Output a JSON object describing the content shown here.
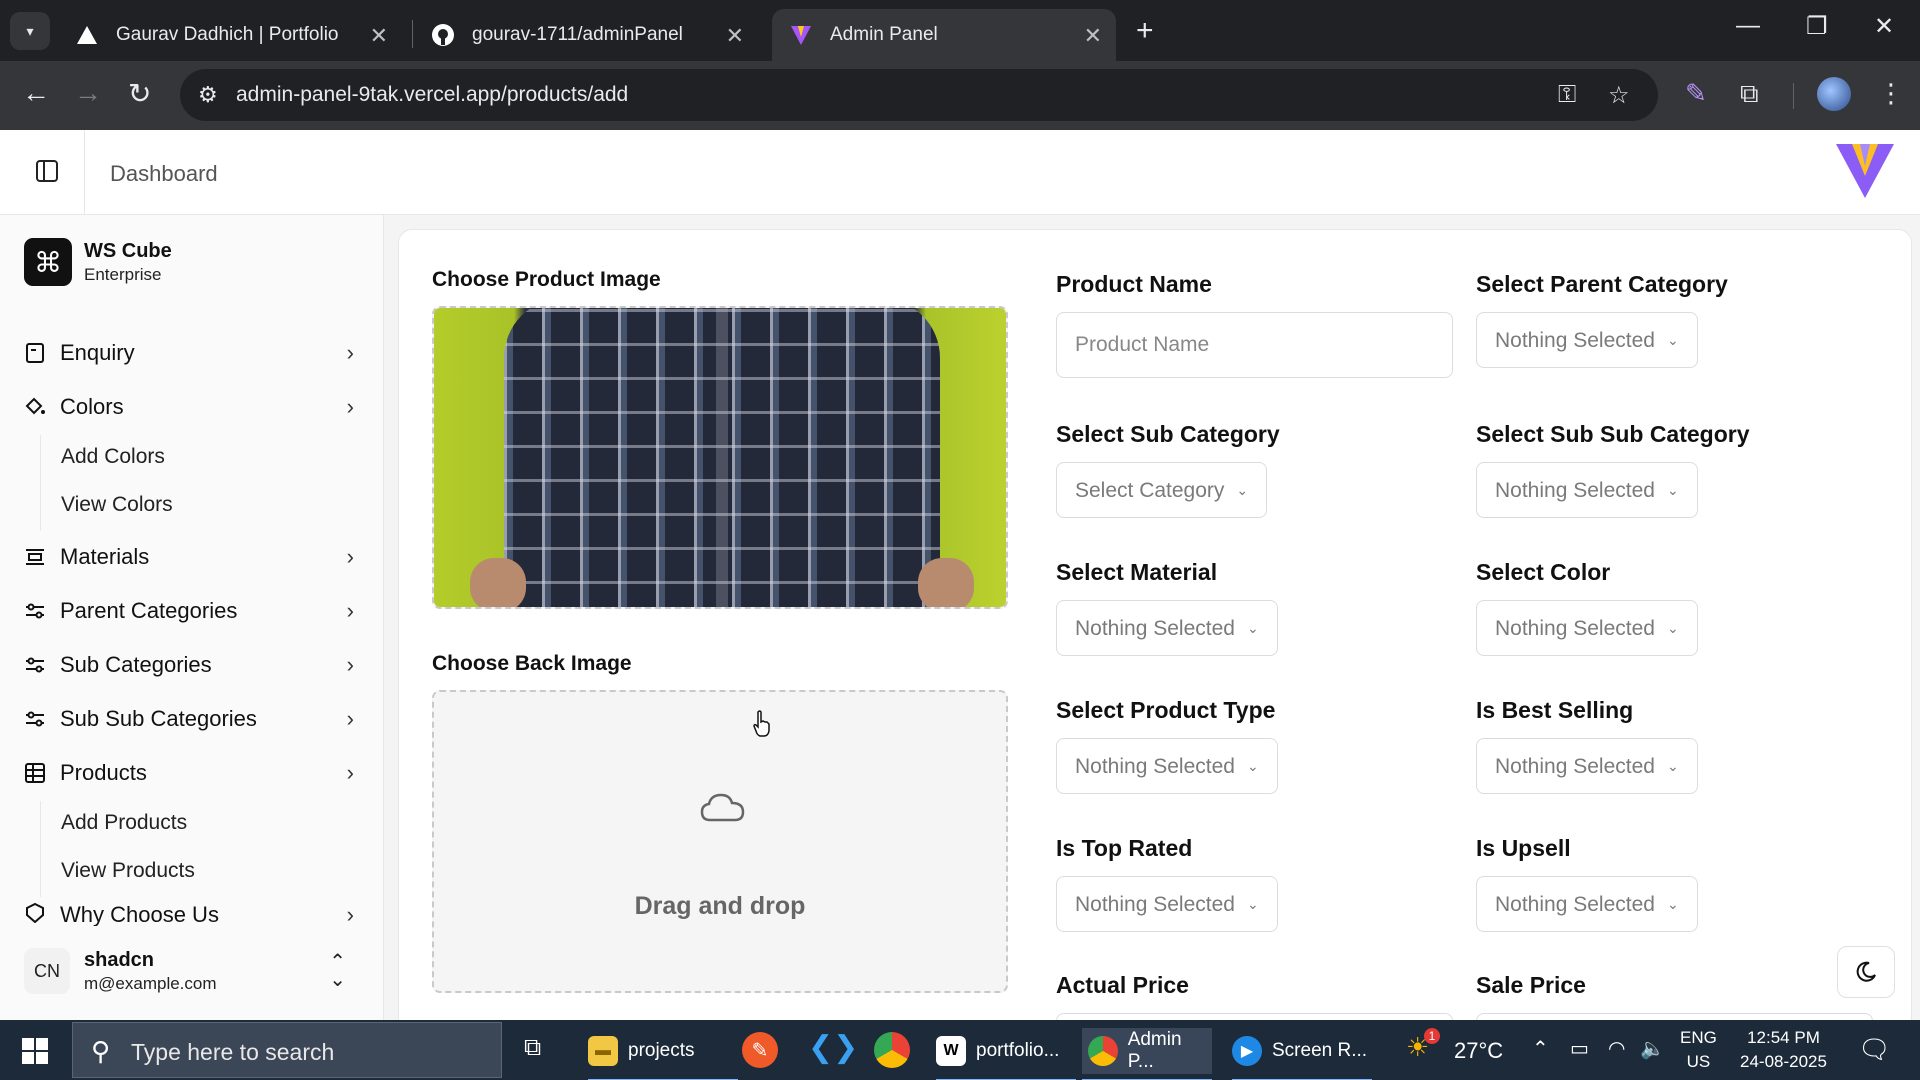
{
  "browser": {
    "tabs": [
      {
        "title": "Gaurav Dadhich | Portfolio",
        "favicon": "triangle-icon"
      },
      {
        "title": "gourav-1711/adminPanel",
        "favicon": "github-icon"
      },
      {
        "title": "Admin Panel",
        "favicon": "vite-icon"
      }
    ],
    "url": "admin-panel-9tak.vercel.app/products/add"
  },
  "header": {
    "breadcrumb": "Dashboard"
  },
  "sidebar": {
    "team": {
      "name": "WS Cube",
      "plan": "Enterprise"
    },
    "items": [
      {
        "label": "Enquiry",
        "icon": "file-icon"
      },
      {
        "label": "Colors",
        "icon": "paint-bucket-icon"
      },
      {
        "label": "Materials",
        "icon": "materials-icon"
      },
      {
        "label": "Parent Categories",
        "icon": "sliders-icon"
      },
      {
        "label": "Sub Categories",
        "icon": "sliders-icon"
      },
      {
        "label": "Sub Sub Categories",
        "icon": "sliders-icon"
      },
      {
        "label": "Products",
        "icon": "table-icon"
      },
      {
        "label": "Why Choose Us",
        "icon": "badge-icon"
      }
    ],
    "color_sub": [
      "Add Colors",
      "View Colors"
    ],
    "product_sub": [
      "Add Products",
      "View Products"
    ],
    "user": {
      "initials": "CN",
      "name": "shadcn",
      "email": "m@example.com"
    }
  },
  "form": {
    "product_image_label": "Choose Product Image",
    "back_image_label": "Choose Back Image",
    "drag_drop_text": "Drag and drop",
    "product_name_label": "Product Name",
    "product_name_placeholder": "Product Name",
    "parent_category_label": "Select Parent Category",
    "parent_category_value": "Nothing Selected",
    "sub_category_label": "Select Sub Category",
    "sub_category_value": "Select Category",
    "sub_sub_category_label": "Select Sub Sub Category",
    "sub_sub_category_value": "Nothing Selected",
    "material_label": "Select Material",
    "material_value": "Nothing Selected",
    "color_label": "Select Color",
    "color_value": "Nothing Selected",
    "product_type_label": "Select Product Type",
    "product_type_value": "Nothing Selected",
    "best_selling_label": "Is Best Selling",
    "best_selling_value": "Nothing Selected",
    "top_rated_label": "Is Top Rated",
    "top_rated_value": "Nothing Selected",
    "upsell_label": "Is Upsell",
    "upsell_value": "Nothing Selected",
    "actual_price_label": "Actual Price",
    "sale_price_label": "Sale Price"
  },
  "taskbar": {
    "search_placeholder": "Type here to search",
    "apps": [
      {
        "label": "projects",
        "icon": "folder-icon"
      },
      {
        "label": "portfolio...",
        "icon": "webstorm-icon"
      },
      {
        "label": "Admin P...",
        "icon": "chrome-icon"
      },
      {
        "label": "Screen R...",
        "icon": "zoom-icon"
      }
    ],
    "weather": "27°C",
    "weather_badge": "1",
    "lang_top": "ENG",
    "lang_bottom": "US",
    "time": "12:54 PM",
    "date": "24-08-2025"
  }
}
